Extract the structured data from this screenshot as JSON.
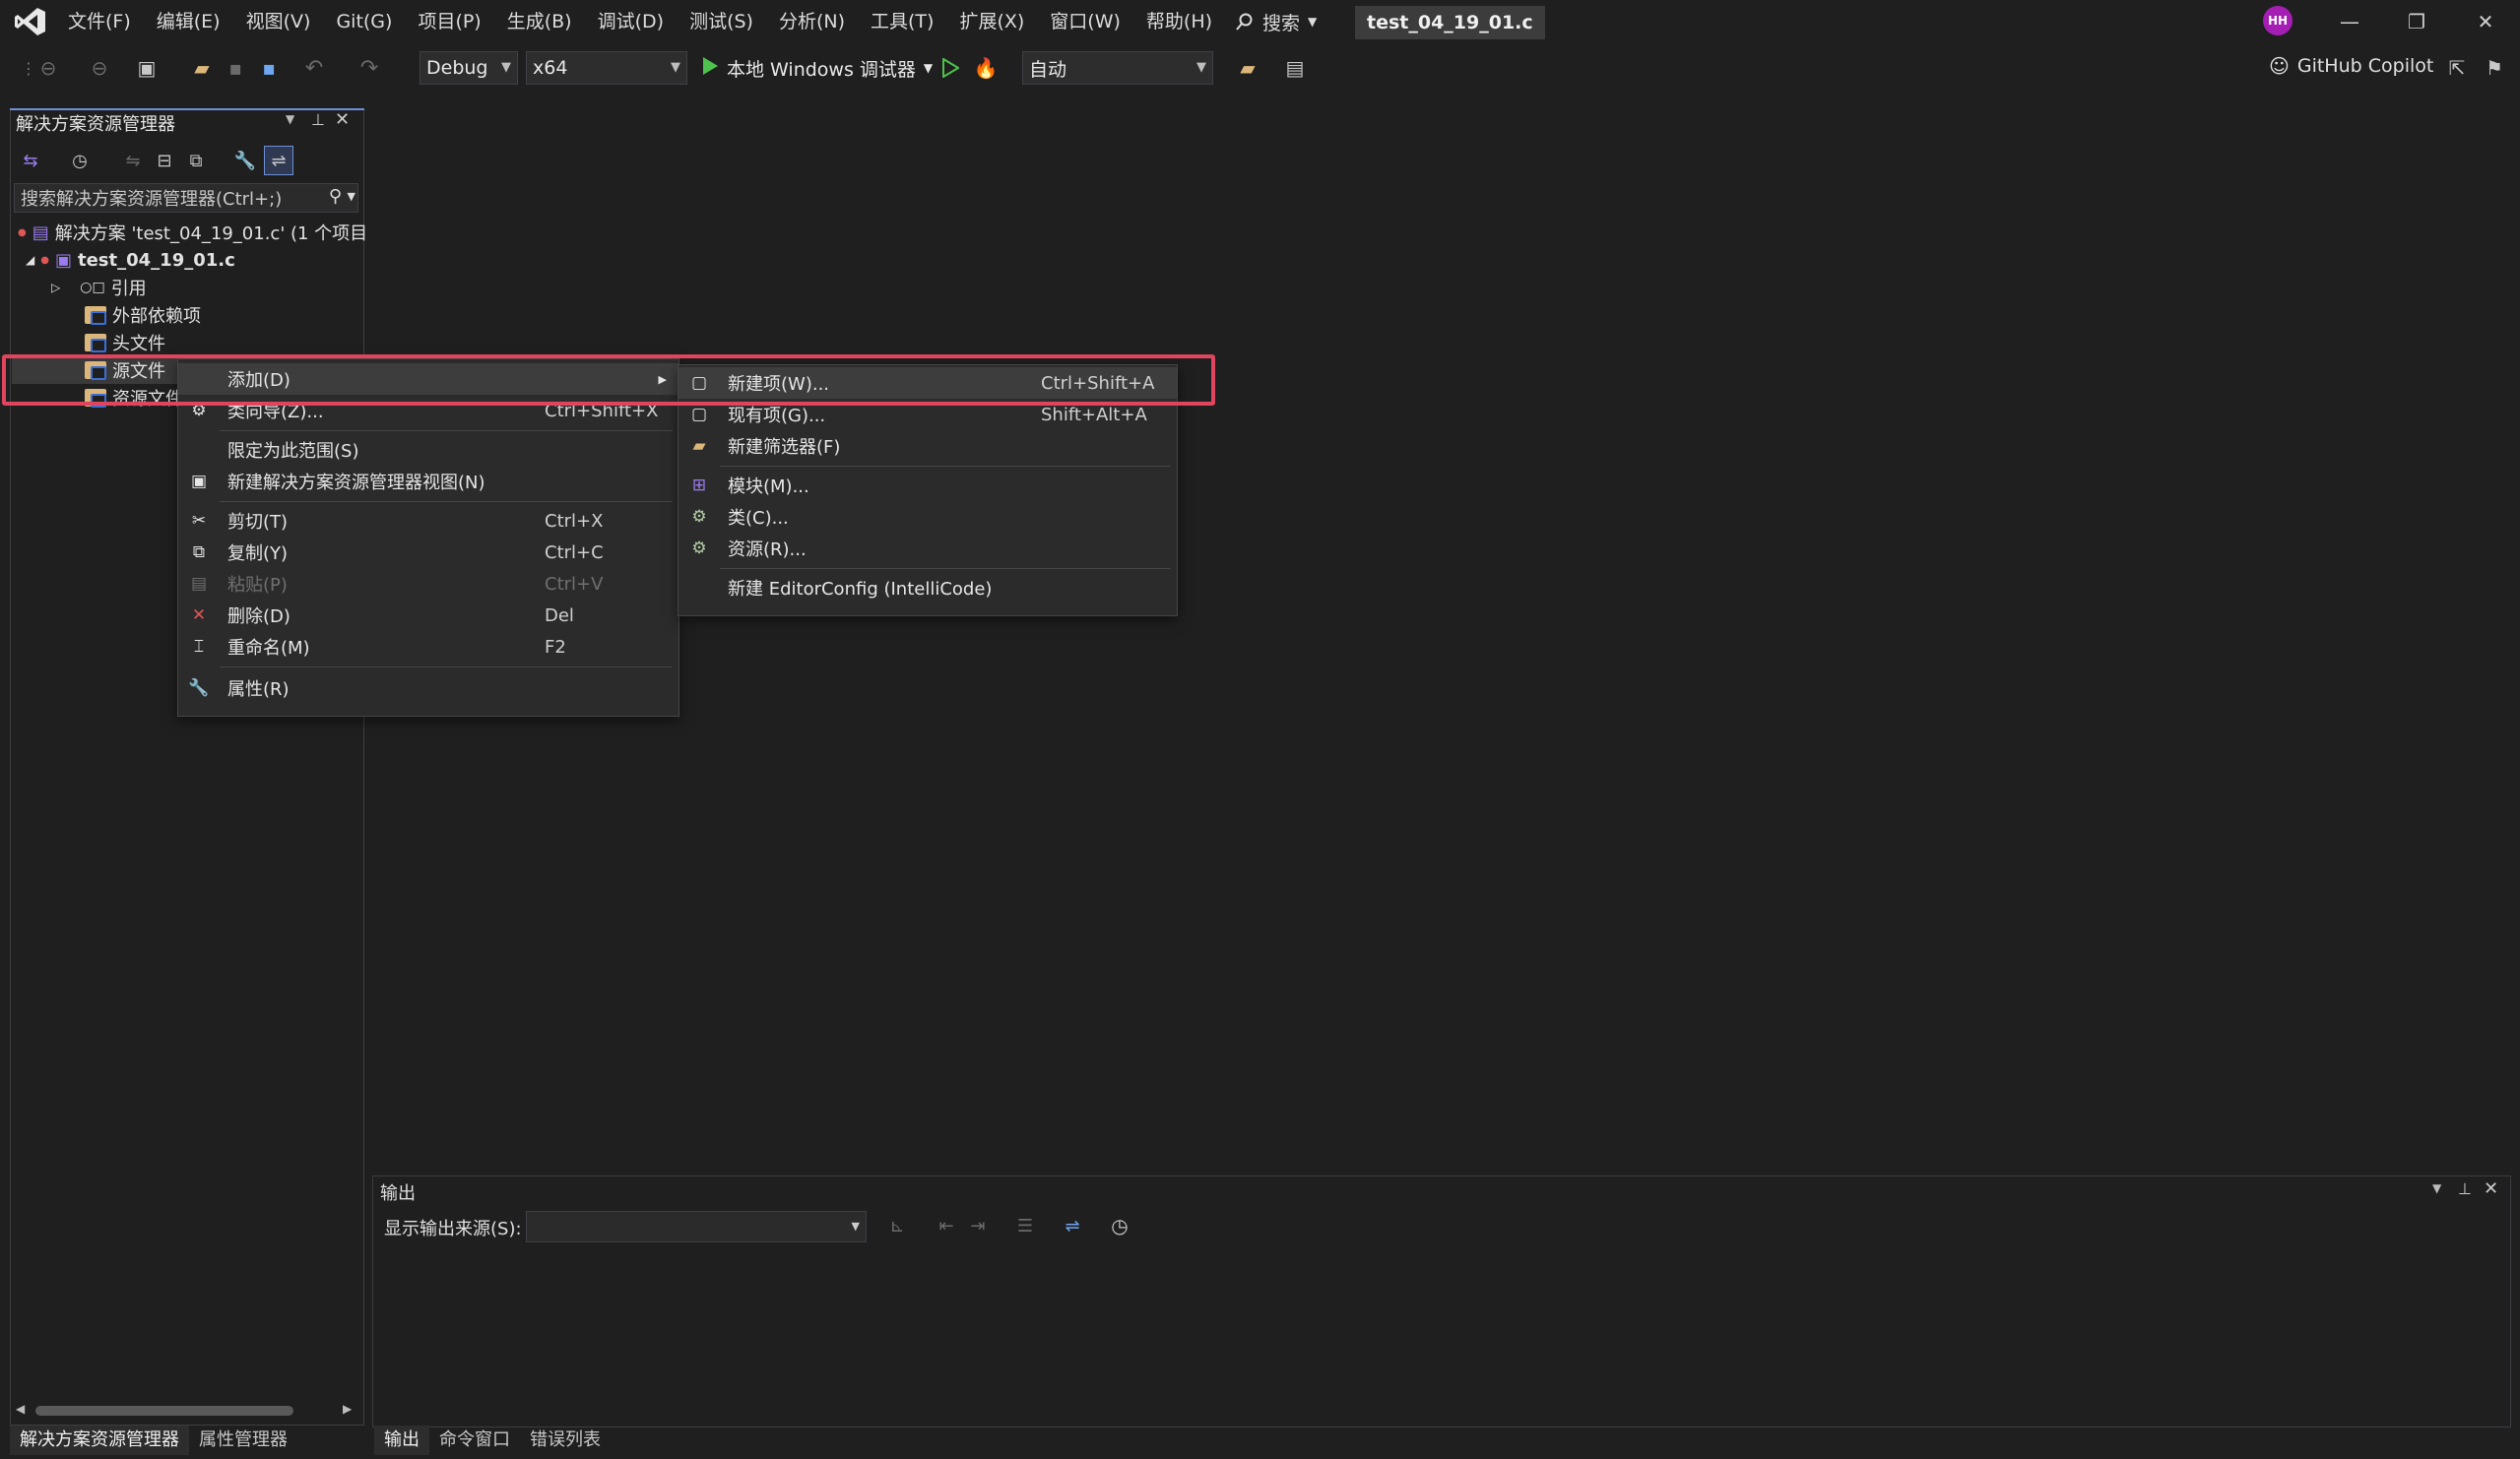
{
  "menubar": {
    "items": [
      "文件(F)",
      "编辑(E)",
      "视图(V)",
      "Git(G)",
      "项目(P)",
      "生成(B)",
      "调试(D)",
      "测试(S)",
      "分析(N)",
      "工具(T)",
      "扩展(X)",
      "窗口(W)",
      "帮助(H)"
    ],
    "search_label": "搜索",
    "doc_title": "test_04_19_01.c",
    "avatar_initials": "HH"
  },
  "toolbar": {
    "config": "Debug",
    "platform": "x64",
    "run_label": "本地 Windows 调试器",
    "auto_combo": "自动",
    "copilot_label": "GitHub Copilot"
  },
  "solution_explorer": {
    "title": "解决方案资源管理器",
    "search_placeholder": "搜索解决方案资源管理器(Ctrl+;)",
    "tree": {
      "solution": "解决方案 'test_04_19_01.c' (1 个项目",
      "project": "test_04_19_01.c",
      "references": "引用",
      "external_deps": "外部依赖项",
      "header_files": "头文件",
      "source_files": "源文件",
      "resource_files": "资源文件"
    },
    "bottom_tabs": [
      "解决方案资源管理器",
      "属性管理器"
    ]
  },
  "context_menu": {
    "items": [
      {
        "label": "添加(D)",
        "shortcut": "",
        "icon": "none",
        "submenu": true
      },
      {
        "label": "类向导(Z)...",
        "shortcut": "Ctrl+Shift+X",
        "icon": "class-wizard-icon"
      },
      {
        "label": "限定为此范围(S)",
        "shortcut": "",
        "icon": "none"
      },
      {
        "label": "新建解决方案资源管理器视图(N)",
        "shortcut": "",
        "icon": "new-view-icon"
      },
      {
        "label": "剪切(T)",
        "shortcut": "Ctrl+X",
        "icon": "cut-icon"
      },
      {
        "label": "复制(Y)",
        "shortcut": "Ctrl+C",
        "icon": "copy-icon"
      },
      {
        "label": "粘贴(P)",
        "shortcut": "Ctrl+V",
        "icon": "paste-icon",
        "disabled": true
      },
      {
        "label": "删除(D)",
        "shortcut": "Del",
        "icon": "delete-icon"
      },
      {
        "label": "重命名(M)",
        "shortcut": "F2",
        "icon": "rename-icon"
      },
      {
        "label": "属性(R)",
        "shortcut": "",
        "icon": "wrench-icon"
      }
    ]
  },
  "submenu": {
    "items": [
      {
        "label": "新建项(W)...",
        "shortcut": "Ctrl+Shift+A",
        "icon": "new-item-icon"
      },
      {
        "label": "现有项(G)...",
        "shortcut": "Shift+Alt+A",
        "icon": "existing-item-icon"
      },
      {
        "label": "新建筛选器(F)",
        "shortcut": "",
        "icon": "new-filter-icon"
      },
      {
        "label": "模块(M)...",
        "shortcut": "",
        "icon": "module-icon"
      },
      {
        "label": "类(C)...",
        "shortcut": "",
        "icon": "class-icon"
      },
      {
        "label": "资源(R)...",
        "shortcut": "",
        "icon": "resource-icon"
      },
      {
        "label": "新建 EditorConfig (IntelliCode)",
        "shortcut": "",
        "icon": "none"
      }
    ]
  },
  "output": {
    "title": "输出",
    "source_label": "显示输出来源(S):",
    "bottom_tabs": [
      "输出",
      "命令窗口",
      "错误列表"
    ]
  },
  "colors": {
    "accent": "#6c8ed8",
    "highlight_box": "#e0455d",
    "run_green": "#4ec24e",
    "avatar": "#a51eb4"
  }
}
